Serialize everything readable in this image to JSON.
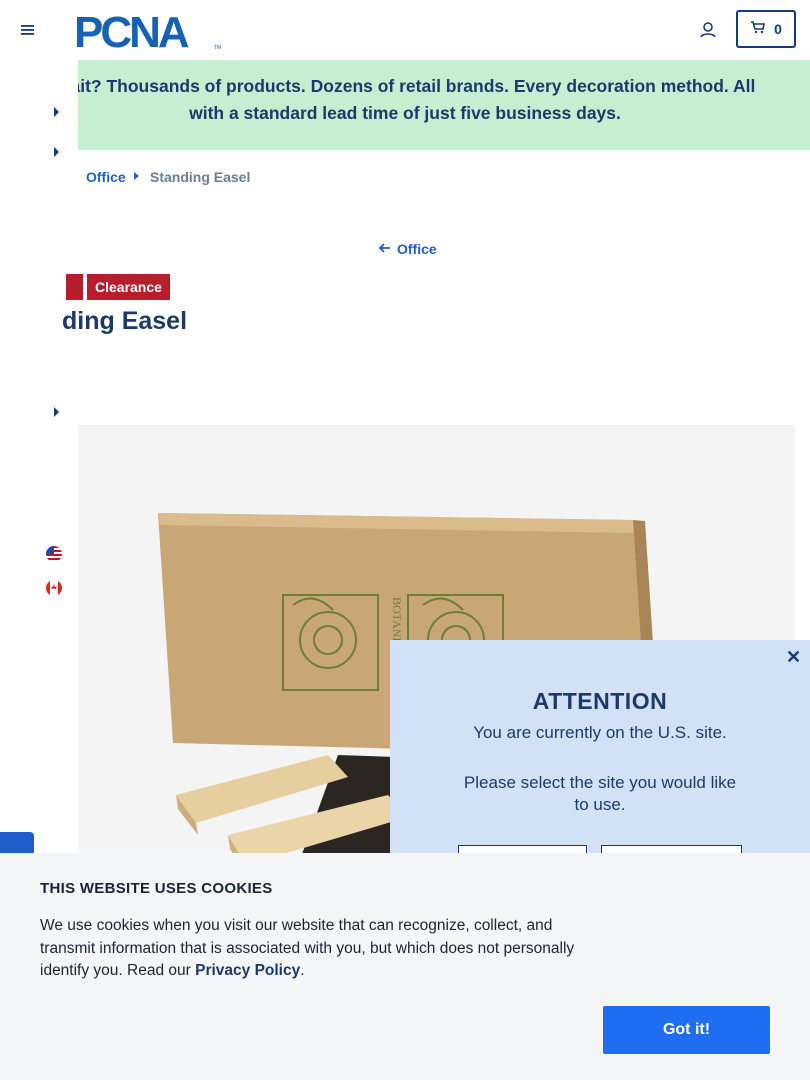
{
  "header": {
    "logo_text": "PCNA",
    "cart_count": "0"
  },
  "banner": {
    "text": "Wait? Thousands of products. Dozens of retail brands. Every decoration method. All\nwith a standard lead time of just five business days."
  },
  "breadcrumb": {
    "parent": "Office",
    "current": "Standing Easel"
  },
  "back_link": {
    "label": "Office"
  },
  "product": {
    "badge": "Clearance",
    "title_visible": "ding Easel",
    "image_icon": "product-box-with-wood-pieces"
  },
  "flags": {
    "us": "us-flag-icon",
    "ca": "canada-flag-icon"
  },
  "modal": {
    "title": "ATTENTION",
    "line1": "You are currently on the U.S. site.",
    "line2": "Please select the site you would like to use."
  },
  "cookie": {
    "title": "THIS WEBSITE USES COOKIES",
    "body": "We use cookies when you visit our website that can recognize, collect, and transmit information that is associated with you, but which does not personally identify you. Read our",
    "link": "Privacy Policy",
    "end": ".",
    "button": "Got it!"
  },
  "colors": {
    "brand_navy": "#123a7e",
    "banner_green": "#c6eed1",
    "clearance_red": "#b81d2c",
    "cookie_button_blue": "#1f6ef2",
    "modal_bg": "#d3e1f7"
  }
}
